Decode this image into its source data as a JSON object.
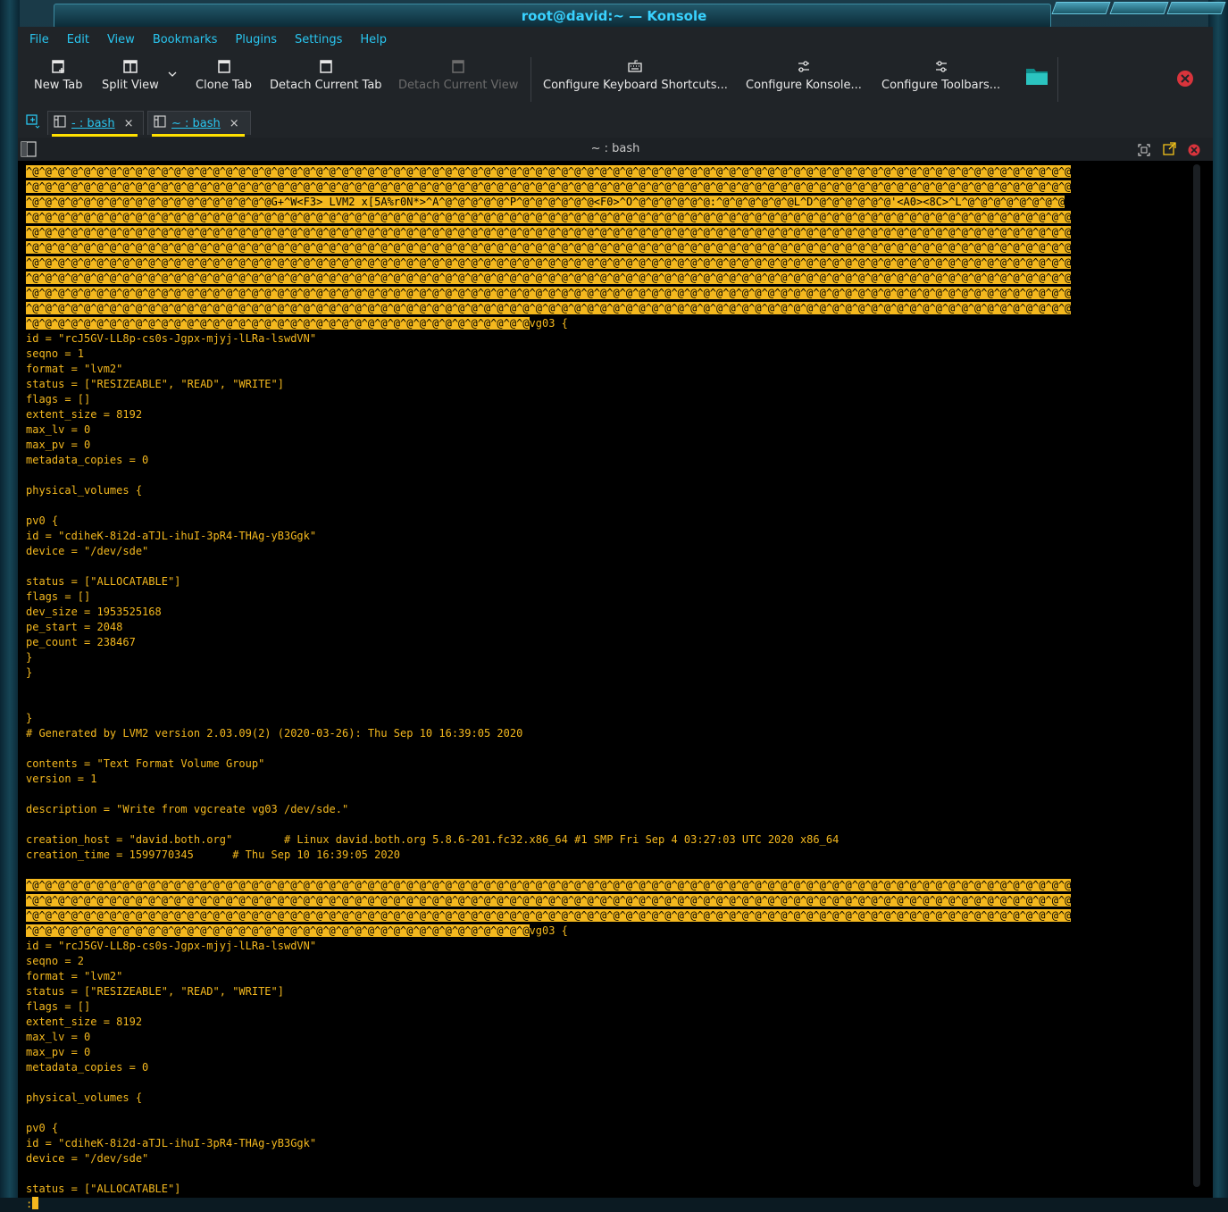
{
  "window": {
    "title": "root@david:~ — Konsole"
  },
  "menu": [
    "File",
    "Edit",
    "View",
    "Bookmarks",
    "Plugins",
    "Settings",
    "Help"
  ],
  "toolbar": {
    "new_tab": "New Tab",
    "split_view": "Split View",
    "clone_tab": "Clone Tab",
    "detach_tab": "Detach Current Tab",
    "detach_view": "Detach Current View",
    "configure_shortcuts": "Configure Keyboard Shortcuts...",
    "configure_konsole": "Configure Konsole...",
    "configure_toolbars": "Configure Toolbars..."
  },
  "tabs": [
    {
      "label": "- : bash",
      "close": "×"
    },
    {
      "label": "~ : bash",
      "close": "×"
    }
  ],
  "terminal": {
    "title": "~ : bash",
    "hl_block1": "^@^@^@^@^@^@^@^@^@^@^@^@^@^@^@^@^@^@^@^@^@^@^@^@^@^@^@^@^@^@^@^@^@^@^@^@^@^@^@^@^@^@^@^@^@^@^@^@^@^@^@^@^@^@^@^@^@^@^@^@^@^@^@^@^@^@^@^@^@^@^@^@^@^@^@^@^@^@^@^@^@\n^@^@^@^@^@^@^@^@^@^@^@^@^@^@^@^@^@^@^@^@^@^@^@^@^@^@^@^@^@^@^@^@^@^@^@^@^@^@^@^@^@^@^@^@^@^@^@^@^@^@^@^@^@^@^@^@^@^@^@^@^@^@^@^@^@^@^@^@^@^@^@^@^@^@^@^@^@^@^@^@^@\n",
    "line3": "^@^@^@^@^@^@^@^@^@^@^@^@^@^@^@^@^@^@^@G+^W<F3> LVM2 x[5A%r0N*>^A^@^@^@^@^@^P^@^@^@^@^@^@<F0>^O^@^@^@^@^@^@:^@^@^@^@^@^@L^D^@^@^@^@^@^@'<A0><8C>^L^@^@^@^@^@^@^@^@\n",
    "hl_block2": "^@^@^@^@^@^@^@^@^@^@^@^@^@^@^@^@^@^@^@^@^@^@^@^@^@^@^@^@^@^@^@^@^@^@^@^@^@^@^@^@^@^@^@^@^@^@^@^@^@^@^@^@^@^@^@^@^@^@^@^@^@^@^@^@^@^@^@^@^@^@^@^@^@^@^@^@^@^@^@^@^@\n^@^@^@^@^@^@^@^@^@^@^@^@^@^@^@^@^@^@^@^@^@^@^@^@^@^@^@^@^@^@^@^@^@^@^@^@^@^@^@^@^@^@^@^@^@^@^@^@^@^@^@^@^@^@^@^@^@^@^@^@^@^@^@^@^@^@^@^@^@^@^@^@^@^@^@^@^@^@^@^@^@\n^@^@^@^@^@^@^@^@^@^@^@^@^@^@^@^@^@^@^@^@^@^@^@^@^@^@^@^@^@^@^@^@^@^@^@^@^@^@^@^@^@^@^@^@^@^@^@^@^@^@^@^@^@^@^@^@^@^@^@^@^@^@^@^@^@^@^@^@^@^@^@^@^@^@^@^@^@^@^@^@^@\n^@^@^@^@^@^@^@^@^@^@^@^@^@^@^@^@^@^@^@^@^@^@^@^@^@^@^@^@^@^@^@^@^@^@^@^@^@^@^@^@^@^@^@^@^@^@^@^@^@^@^@^@^@^@^@^@^@^@^@^@^@^@^@^@^@^@^@^@^@^@^@^@^@^@^@^@^@^@^@^@^@\n^@^@^@^@^@^@^@^@^@^@^@^@^@^@^@^@^@^@^@^@^@^@^@^@^@^@^@^@^@^@^@^@^@^@^@^@^@^@^@^@^@^@^@^@^@^@^@^@^@^@^@^@^@^@^@^@^@^@^@^@^@^@^@^@^@^@^@^@^@^@^@^@^@^@^@^@^@^@^@^@^@\n^@^@^@^@^@^@^@^@^@^@^@^@^@^@^@^@^@^@^@^@^@^@^@^@^@^@^@^@^@^@^@^@^@^@^@^@^@^@^@^@^@^@^@^@^@^@^@^@^@^@^@^@^@^@^@^@^@^@^@^@^@^@^@^@^@^@^@^@^@^@^@^@^@^@^@^@^@^@^@^@^@\n^@^@^@^@^@^@^@^@^@^@^@^@^@^@^@^@^@^@^@^@^@^@^@^@^@^@^@^@^@^@^@^@^@^@^@^@^@^@^@^@^@^@^@^@^@^@^@^@^@^@^@^@^@^@^@^@^@^@^@^@^@^@^@^@^@^@^@^@^@^@^@^@^@^@^@^@^@^@^@^@^@\n^@^@^@^@^@^@^@^@^@^@^@^@^@^@^@^@^@^@^@^@^@^@^@^@^@^@^@^@^@^@^@^@^@^@^@^@^@^@^@",
    "body1": "vg03 {\nid = \"rcJ5GV-LL8p-cs0s-Jgpx-mjyj-lLRa-lswdVN\"\nseqno = 1\nformat = \"lvm2\"\nstatus = [\"RESIZEABLE\", \"READ\", \"WRITE\"]\nflags = []\nextent_size = 8192\nmax_lv = 0\nmax_pv = 0\nmetadata_copies = 0\n\nphysical_volumes {\n\npv0 {\nid = \"cdiheK-8i2d-aTJL-ihuI-3pR4-THAg-yB3Ggk\"\ndevice = \"/dev/sde\"\n\nstatus = [\"ALLOCATABLE\"]\nflags = []\ndev_size = 1953525168\npe_start = 2048\npe_count = 238467\n}\n}\n\n\n}\n# Generated by LVM2 version 2.03.09(2) (2020-03-26): Thu Sep 10 16:39:05 2020\n\ncontents = \"Text Format Volume Group\"\nversion = 1\n\ndescription = \"Write from vgcreate vg03 /dev/sde.\"\n\ncreation_host = \"david.both.org\"        # Linux david.both.org 5.8.6-201.fc32.x86_64 #1 SMP Fri Sep 4 03:27:03 UTC 2020 x86_64\ncreation_time = 1599770345      # Thu Sep 10 16:39:05 2020\n\n",
    "hl_block3": "^@^@^@^@^@^@^@^@^@^@^@^@^@^@^@^@^@^@^@^@^@^@^@^@^@^@^@^@^@^@^@^@^@^@^@^@^@^@^@^@^@^@^@^@^@^@^@^@^@^@^@^@^@^@^@^@^@^@^@^@^@^@^@^@^@^@^@^@^@^@^@^@^@^@^@^@^@^@^@^@^@\n^@^@^@^@^@^@^@^@^@^@^@^@^@^@^@^@^@^@^@^@^@^@^@^@^@^@^@^@^@^@^@^@^@^@^@^@^@^@^@^@^@^@^@^@^@^@^@^@^@^@^@^@^@^@^@^@^@^@^@^@^@^@^@^@^@^@^@^@^@^@^@^@^@^@^@^@^@^@^@^@^@\n^@^@^@^@^@^@^@^@^@^@^@^@^@^@^@^@^@^@^@^@^@^@^@^@^@^@^@^@^@^@^@^@^@^@^@^@^@^@^@^@^@^@^@^@^@^@^@^@^@^@^@^@^@^@^@^@^@^@^@^@^@^@^@^@^@^@^@^@^@^@^@^@^@^@^@^@^@^@^@^@^@\n^@^@^@^@^@^@^@^@^@^@^@^@^@^@^@^@^@^@^@^@^@^@^@^@^@^@^@^@^@^@^@^@^@^@^@^@^@^@^@",
    "body2": "vg03 {\nid = \"rcJ5GV-LL8p-cs0s-Jgpx-mjyj-lLRa-lswdVN\"\nseqno = 2\nformat = \"lvm2\"\nstatus = [\"RESIZEABLE\", \"READ\", \"WRITE\"]\nflags = []\nextent_size = 8192\nmax_lv = 0\nmax_pv = 0\nmetadata_copies = 0\n\nphysical_volumes {\n\npv0 {\nid = \"cdiheK-8i2d-aTJL-ihuI-3pR4-THAg-yB3Ggk\"\ndevice = \"/dev/sde\"\n\nstatus = [\"ALLOCATABLE\"]\n",
    "prompt": ":"
  },
  "colors": {
    "accent": "#29c6f0",
    "terminal_fg": "#f4b81e",
    "tab_underline": "#ffe000"
  }
}
